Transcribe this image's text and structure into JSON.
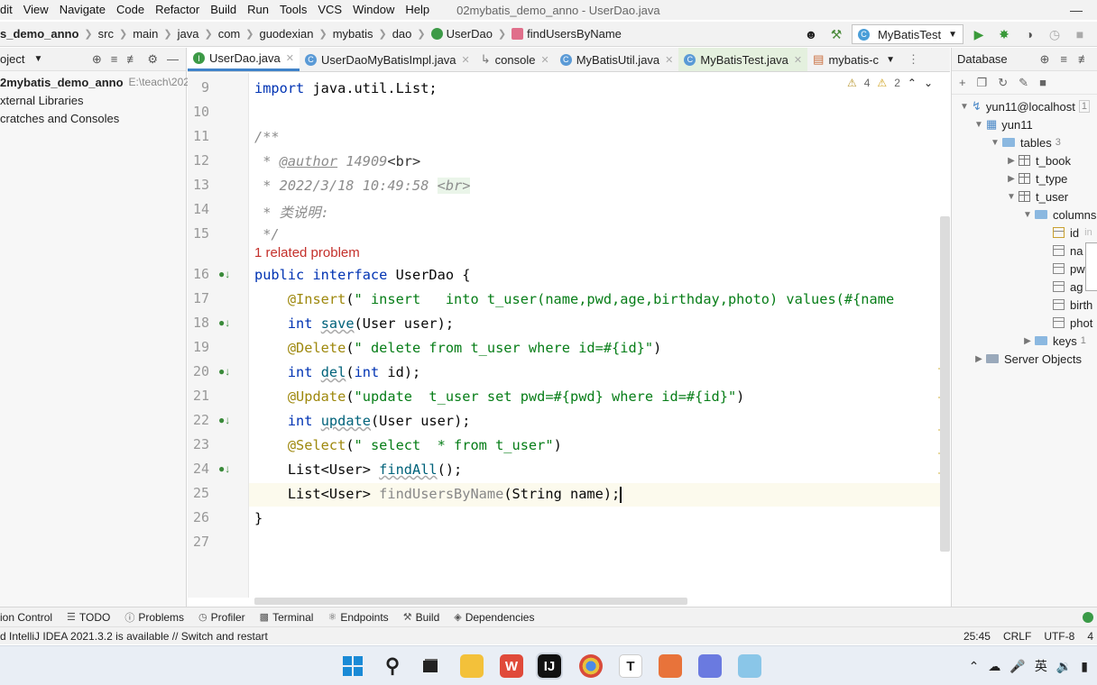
{
  "menubar": {
    "items": [
      "dit",
      "View",
      "Navigate",
      "Code",
      "Refactor",
      "Build",
      "Run",
      "Tools",
      "VCS",
      "Window",
      "Help"
    ],
    "window_title": "02mybatis_demo_anno - UserDao.java"
  },
  "navbar": {
    "crumbs": [
      "s_demo_anno",
      "src",
      "main",
      "java",
      "com",
      "guodexian",
      "mybatis",
      "dao",
      "UserDao",
      "findUsersByName"
    ],
    "run_config": "MyBatisTest"
  },
  "project": {
    "header": "oject",
    "items": [
      {
        "label": "2mybatis_demo_anno",
        "path": "E:\\teach\\202"
      },
      {
        "label": "xternal Libraries",
        "path": ""
      },
      {
        "label": "cratches and Consoles",
        "path": ""
      }
    ]
  },
  "tabs": [
    {
      "label": "UserDao.java",
      "icon": "interface-icon",
      "active": true
    },
    {
      "label": "UserDaoMyBatisImpl.java",
      "icon": "class-icon",
      "active": false
    },
    {
      "label": "console",
      "icon": "console-icon",
      "active": false
    },
    {
      "label": "MyBatisUtil.java",
      "icon": "class-icon",
      "active": false
    },
    {
      "label": "MyBatisTest.java",
      "icon": "class-icon",
      "active": false
    },
    {
      "label": "mybatis-c",
      "icon": "xml-icon",
      "active": false
    }
  ],
  "inspections": {
    "warnings": "4",
    "weak_warnings": "2"
  },
  "editor": {
    "line_numbers": [
      "9",
      "10",
      "11",
      "12",
      "13",
      "14",
      "15",
      "16",
      "17",
      "18",
      "19",
      "20",
      "21",
      "22",
      "23",
      "24",
      "25",
      "26",
      "27"
    ],
    "related_problem": "1 related problem",
    "lines": {
      "l9_kw": "import",
      "l9_rest": " java.util.List;",
      "l11": "/**",
      "l12_a": " * ",
      "l12_tag": "@author",
      "l12_b": " 14909",
      "l12_c": "<br>",
      "l13_a": " * 2022/3/18 10:49:58 ",
      "l13_tag": "<br>",
      "l14": " * 类说明:",
      "l15": " */",
      "l16_kw": "public interface",
      "l16_rest": " UserDao {",
      "l17_ann": "@Insert",
      "l17_p": "(",
      "l17_str": "\" insert   into t_user(name,pwd,age,birthday,photo) values(#{name",
      "l18_kw": "int",
      "l18_fn": "save",
      "l18_rest": "(User user);",
      "l19_ann": "@Delete",
      "l19_str": "\" delete from t_user where id=#{id}\"",
      "l20_kw": "int",
      "l20_fn": "del",
      "l20_p": "(",
      "l20_kw2": "int",
      "l20_rest": " id);",
      "l21_ann": "@Update",
      "l21_str": "\"update  t_user set pwd=#{pwd} where id=#{id}\"",
      "l22_kw": "int",
      "l22_fn": "update",
      "l22_rest": "(User user);",
      "l23_ann": "@Select",
      "l23_str": "\" select  * from t_user\"",
      "l24_a": "List<User> ",
      "l24_fn": "findAll",
      "l24_rest": "();",
      "l25_a": "List<User> ",
      "l25_fn": "findUsersByName",
      "l25_rest": "(String name);",
      "l26": "}"
    }
  },
  "database": {
    "header": "Database",
    "host": "yun11@localhost",
    "host_count": "1",
    "schema": "yun11",
    "tables_label": "tables",
    "tables_count": "3",
    "tables": [
      "t_book",
      "t_type",
      "t_user"
    ],
    "columns_label": "columns",
    "columns": [
      "id",
      "na",
      "pw",
      "ag",
      "birth",
      "phot"
    ],
    "id_type": "in",
    "keys_label": "keys",
    "keys_count": "1",
    "server_objects": "Server Objects"
  },
  "tool_strip": [
    "ion Control",
    "TODO",
    "Problems",
    "Profiler",
    "Terminal",
    "Endpoints",
    "Build",
    "Dependencies"
  ],
  "status": {
    "message": "d IntelliJ IDEA 2021.3.2 is available // Switch and restart",
    "position": "25:45",
    "line_sep": "CRLF",
    "encoding": "UTF-8",
    "indent": "4"
  },
  "taskbar": {
    "tray_lang": "英"
  }
}
